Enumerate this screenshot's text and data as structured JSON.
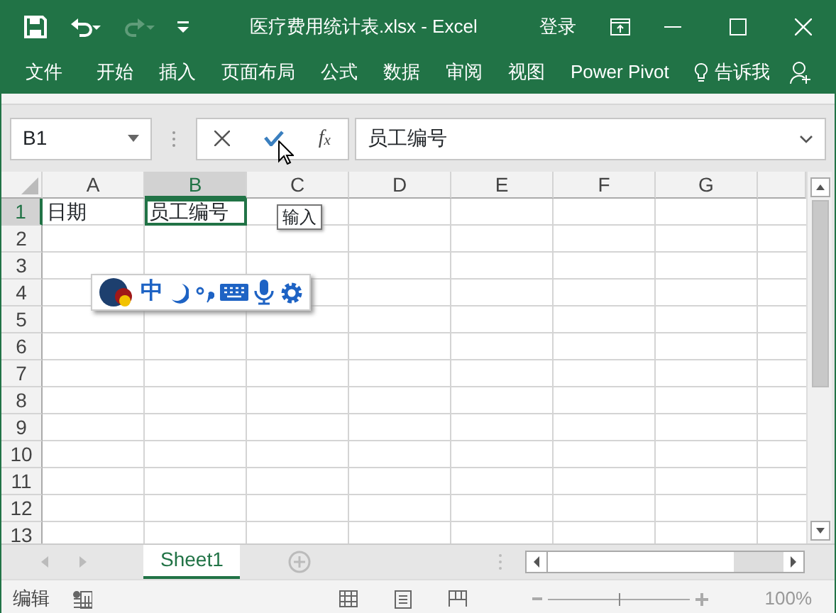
{
  "window": {
    "title": "医疗费用统计表.xlsx - Excel",
    "sign_in": "登录"
  },
  "quick_access": [
    {
      "kind": "save",
      "disabled": false
    },
    {
      "kind": "undo",
      "disabled": false
    },
    {
      "kind": "redo",
      "disabled": true
    },
    {
      "kind": "customize",
      "disabled": false
    }
  ],
  "ribbon_tabs": [
    {
      "label": "文件",
      "kind": "tab"
    },
    {
      "label": "开始",
      "kind": "tab"
    },
    {
      "label": "插入",
      "kind": "tab"
    },
    {
      "label": "页面布局",
      "kind": "tab"
    },
    {
      "label": "公式",
      "kind": "tab"
    },
    {
      "label": "数据",
      "kind": "tab"
    },
    {
      "label": "审阅",
      "kind": "tab"
    },
    {
      "label": "视图",
      "kind": "tab"
    },
    {
      "label": "Power Pivot",
      "kind": "tab"
    },
    {
      "label": "告诉我",
      "kind": "tell_me"
    }
  ],
  "name_box": {
    "value": "B1"
  },
  "formula_bar": {
    "function_label": "f$_{x}$",
    "value": "员工编号",
    "tooltip": "输入"
  },
  "columns": [
    {
      "label": "A",
      "selected": false
    },
    {
      "label": "B",
      "selected": true
    },
    {
      "label": "C",
      "selected": false
    },
    {
      "label": "D",
      "selected": false
    },
    {
      "label": "E",
      "selected": false
    },
    {
      "label": "F",
      "selected": false
    },
    {
      "label": "G",
      "selected": false
    }
  ],
  "rows": [
    {
      "label": "1",
      "selected": true,
      "cells": [
        "日期",
        "员工编号"
      ]
    },
    {
      "label": "2",
      "selected": false
    },
    {
      "label": "3",
      "selected": false
    },
    {
      "label": "4",
      "selected": false
    },
    {
      "label": "5",
      "selected": false
    },
    {
      "label": "6",
      "selected": false
    },
    {
      "label": "7",
      "selected": false
    },
    {
      "label": "8",
      "selected": false
    },
    {
      "label": "9",
      "selected": false
    },
    {
      "label": "10",
      "selected": false
    },
    {
      "label": "11",
      "selected": false
    },
    {
      "label": "12",
      "selected": false
    },
    {
      "label": "13",
      "selected": false
    }
  ],
  "ime_toolbar": {
    "mode": "中"
  },
  "sheet_tabs": [
    {
      "label": "Sheet1",
      "selected": true
    }
  ],
  "status_bar": {
    "mode": "编辑",
    "zoom": "100%",
    "zoom_slider": {
      "level": 0.5
    }
  }
}
